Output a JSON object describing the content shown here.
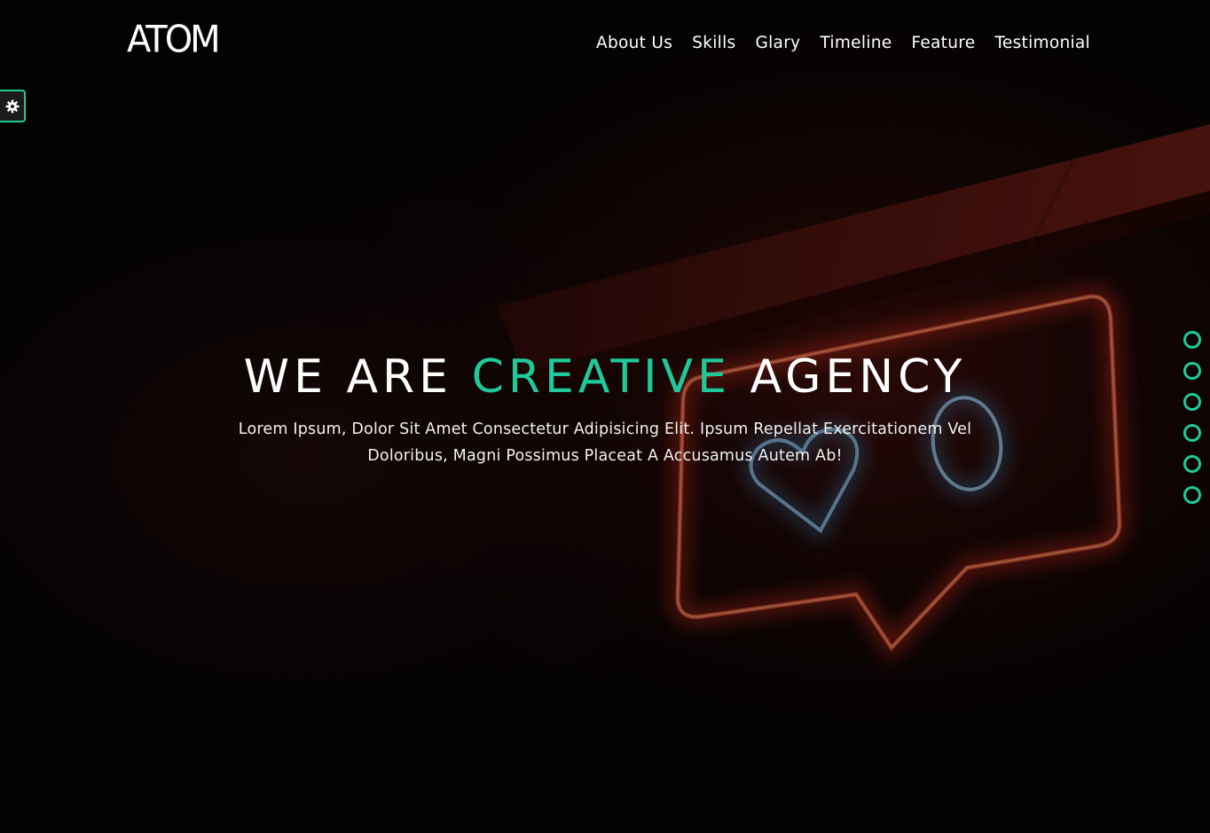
{
  "brand": {
    "logo_text": "ATOM"
  },
  "nav": {
    "items": [
      {
        "label": "About Us"
      },
      {
        "label": "Skills"
      },
      {
        "label": "Glary"
      },
      {
        "label": "Timeline"
      },
      {
        "label": "Feature"
      },
      {
        "label": "Testimonial"
      }
    ]
  },
  "settings": {
    "icon": "gear-icon"
  },
  "hero": {
    "title_part1": "WE ARE",
    "title_accent": "CREATIVE",
    "title_part2": "AGENCY",
    "subtitle": "Lorem Ipsum, Dolor Sit Amet Consectetur Adipisicing Elit. Ipsum Repellat Exercitationem Vel Doloribus, Magni Possimus Placeat A Accusamus Autem Ab!"
  },
  "dot_nav": {
    "count": 6
  },
  "colors": {
    "accent": "#1fc99a",
    "neon_red": "#e0302a",
    "neon_blue": "#5ab8ff",
    "text": "#ffffff"
  }
}
